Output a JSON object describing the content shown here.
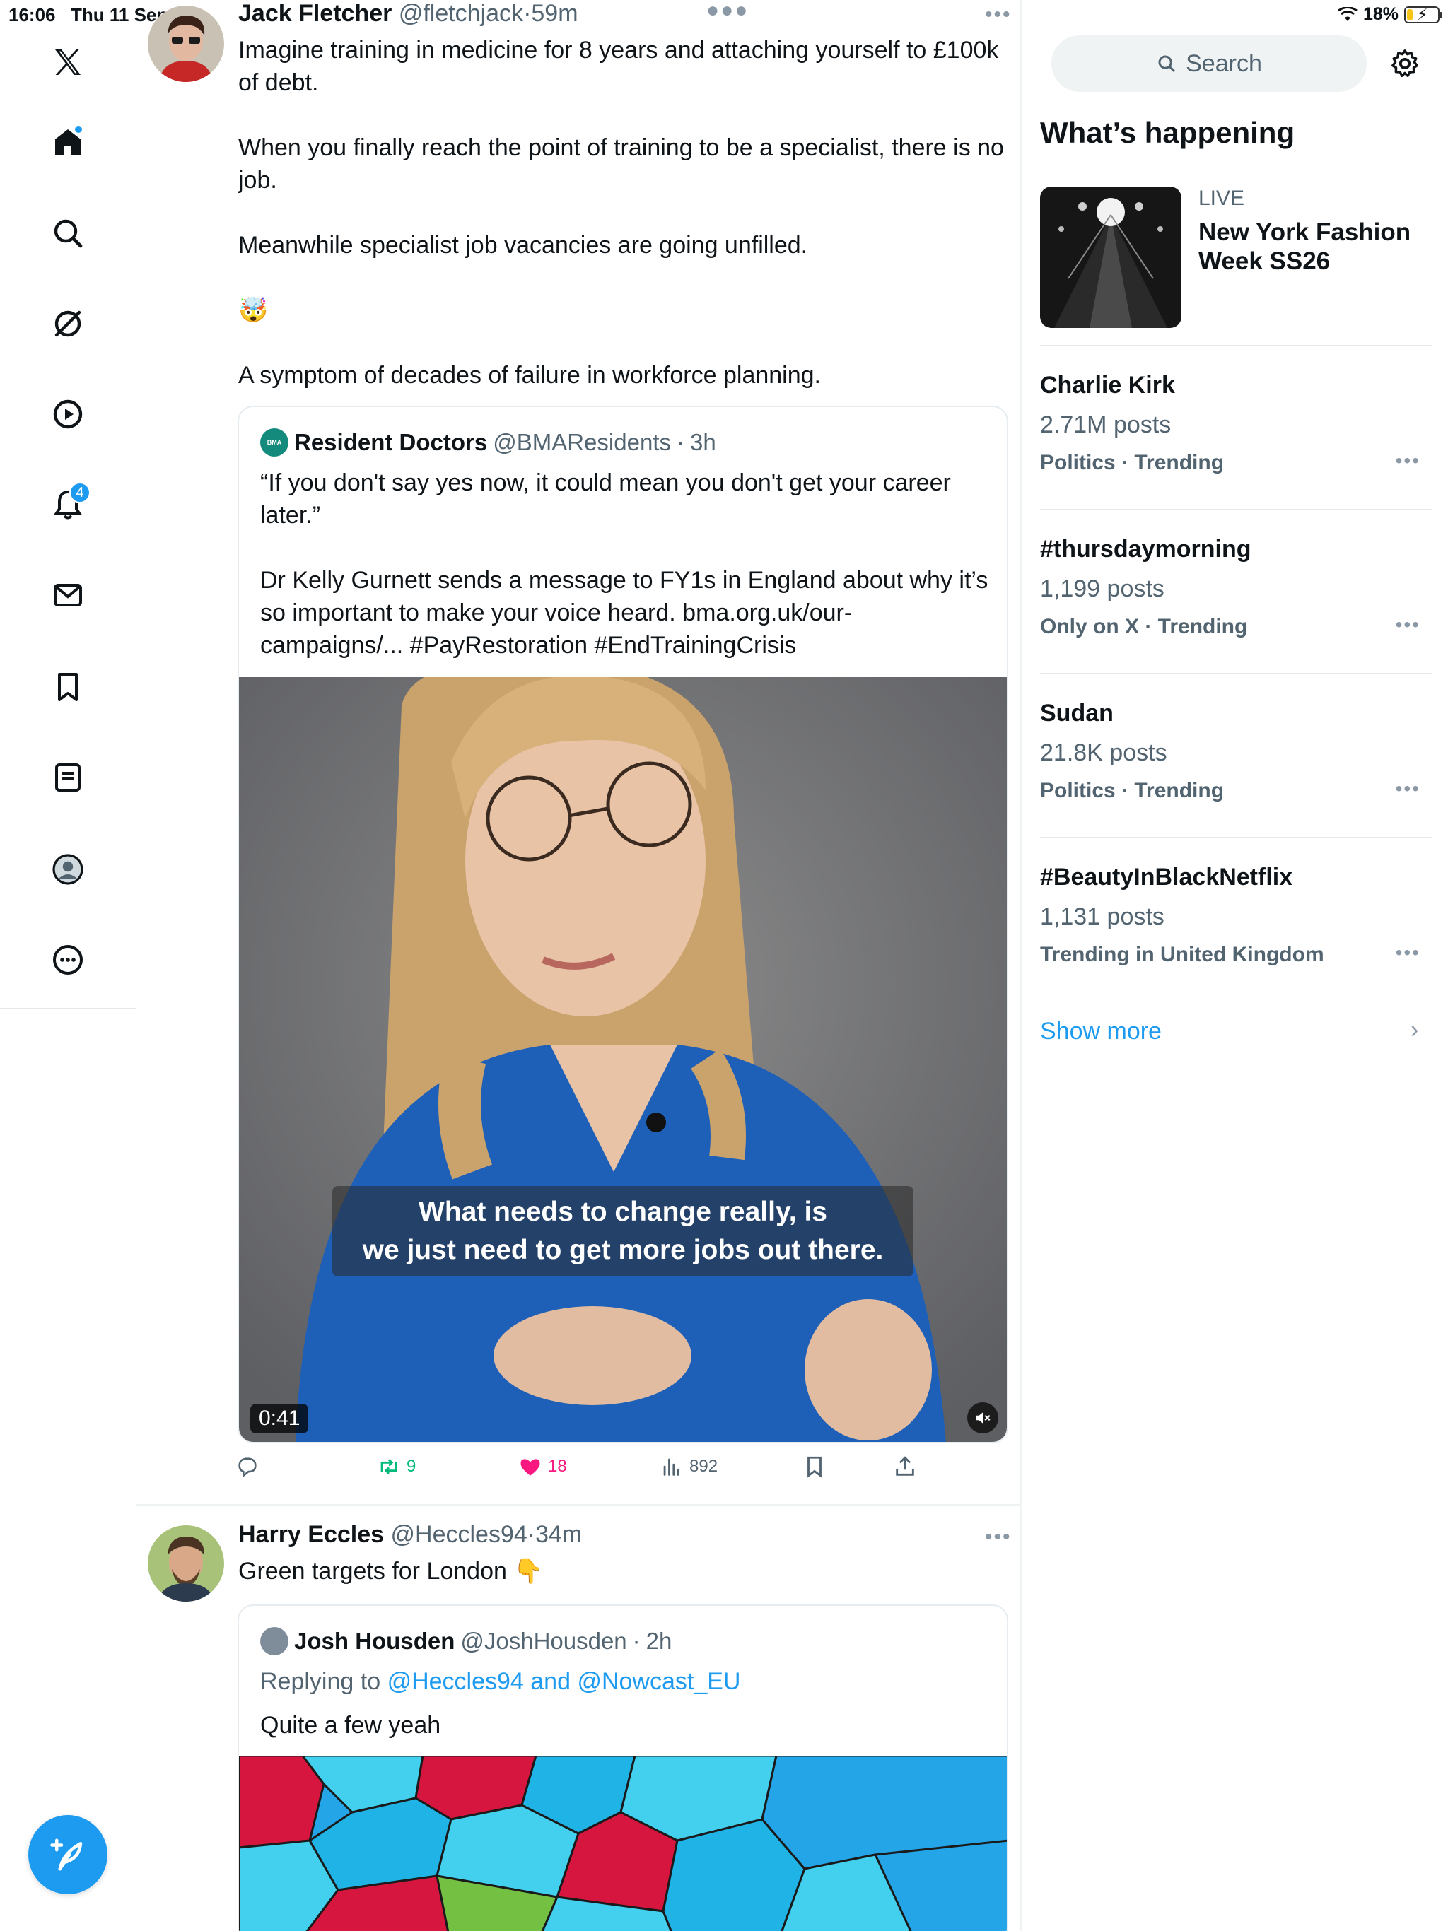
{
  "status_bar": {
    "time": "16:06",
    "date": "Thu 11 Sep",
    "battery": "18%",
    "battery_level": 0.18
  },
  "nav": {
    "notifications_badge": "4",
    "items": [
      "x-logo-icon",
      "home-icon",
      "explore-icon",
      "grok-icon",
      "video-icon",
      "notifications-icon",
      "messages-icon",
      "bookmarks-icon",
      "lists-icon",
      "profile-icon",
      "more-icon"
    ]
  },
  "tweets": [
    {
      "name": "Jack Fletcher",
      "handle": "@fletchjack",
      "time": "59m",
      "text_lines": [
        "Imagine training in medicine for 8 years and attaching yourself to £100k",
        "of debt.",
        "",
        "When you finally reach the point of training to be a specialist, there is no",
        "job.",
        "",
        "Meanwhile specialist job vacancies are going unfilled.",
        "",
        "🤯",
        "",
        "A symptom of decades of failure in workforce planning."
      ],
      "quote": {
        "name": "Resident Doctors",
        "handle": "@BMAResidents",
        "time": "3h",
        "text_lines": [
          "“If you don't say yes now, it could mean you don't get your career",
          "later.”",
          "",
          "Dr Kelly Gurnett sends a message to FY1s in England about why it’s",
          "so important to make your voice heard. bma.org.uk/our-",
          "campaigns/... #PayRestoration #EndTrainingCrisis"
        ],
        "video": {
          "caption_line1": "What needs to change really, is",
          "caption_line2": "we just need to get more jobs out there.",
          "duration": "0:41"
        }
      },
      "actions": {
        "reposts": "9",
        "likes": "18",
        "views": "892"
      }
    },
    {
      "name": "Harry Eccles",
      "handle": "@Heccles94",
      "time": "34m",
      "text": "Green targets for London",
      "emoji": "👇",
      "quote": {
        "name": "Josh Housden",
        "handle": "@JoshHousden",
        "time": "2h",
        "replying_prefix": "Replying to",
        "replying_to": "@Heccles94 and @Nowcast_EU",
        "text": "Quite a few yeah"
      }
    }
  ],
  "sidebar": {
    "search_placeholder": "Search",
    "section_title": "What’s happening",
    "live": {
      "label": "LIVE",
      "title": "New York Fashion Week SS26"
    },
    "trends": [
      {
        "name": "Charlie Kirk",
        "count": "2.71M posts",
        "category": "Politics · Trending"
      },
      {
        "name": "#thursdaymorning",
        "count": "1,199 posts",
        "category": "Only on X · Trending"
      },
      {
        "name": "Sudan",
        "count": "21.8K posts",
        "category": "Politics · Trending"
      },
      {
        "name": "#BeautyInBlackNetflix",
        "count": "1,131 posts",
        "category": "Trending in United Kingdom"
      }
    ],
    "show_more": "Show more"
  },
  "colors": {
    "accent": "#1d9bf0",
    "repost_green": "#00ba7c",
    "like_pink": "#f91880",
    "text": "#0f1419",
    "muted": "#536471"
  }
}
